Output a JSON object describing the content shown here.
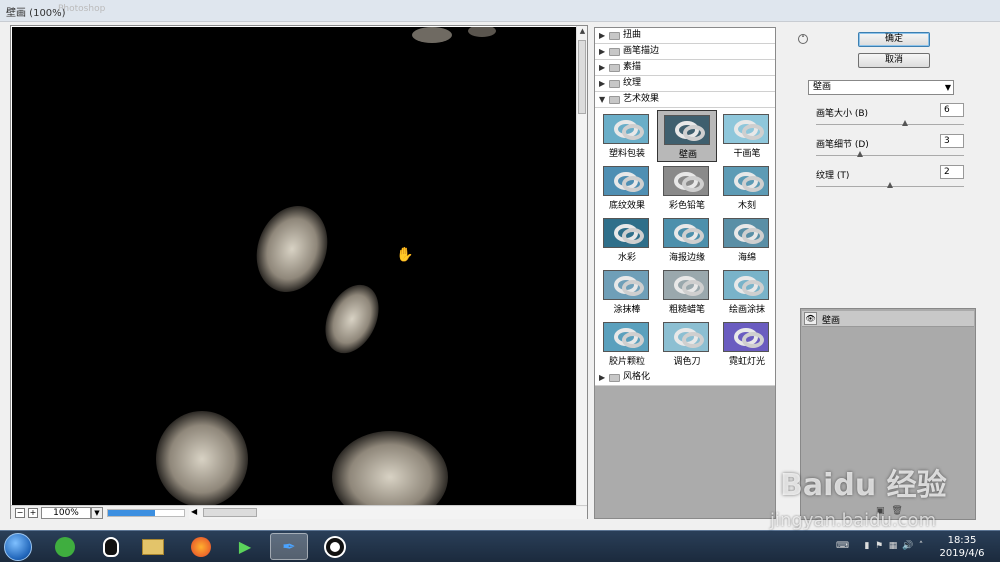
{
  "window": {
    "title": "壁画 (100%)",
    "ghost_title": "Photoshop"
  },
  "preview": {
    "zoom": "100%",
    "progress_fraction": 0.62
  },
  "filter_categories_top": [
    {
      "label": "扭曲"
    },
    {
      "label": "画笔描边"
    },
    {
      "label": "素描"
    },
    {
      "label": "纹理"
    },
    {
      "label": "艺术效果"
    }
  ],
  "artistic_filters": [
    {
      "label": "塑料包装",
      "color": "#6aaec8"
    },
    {
      "label": "壁画",
      "color": "#3f5f6e",
      "selected": true
    },
    {
      "label": "干画笔",
      "color": "#8fc7db"
    },
    {
      "label": "底纹效果",
      "color": "#4f8fb3"
    },
    {
      "label": "彩色铅笔",
      "color": "#8a8a8a"
    },
    {
      "label": "木刻",
      "color": "#5d9bb5"
    },
    {
      "label": "水彩",
      "color": "#2f6f8a"
    },
    {
      "label": "海报边缘",
      "color": "#4d90ac"
    },
    {
      "label": "海绵",
      "color": "#5a8fa6"
    },
    {
      "label": "涂抹棒",
      "color": "#6f9fb8"
    },
    {
      "label": "粗糙蜡笔",
      "color": "#9aa8ad"
    },
    {
      "label": "绘画涂抹",
      "color": "#79b3c9"
    },
    {
      "label": "胶片颗粒",
      "color": "#5aa0bd"
    },
    {
      "label": "调色刀",
      "color": "#8cbfd2"
    },
    {
      "label": "霓虹灯光",
      "color": "#6a5cc0"
    }
  ],
  "filter_categories_bottom": [
    {
      "label": "风格化"
    }
  ],
  "buttons": {
    "ok": "确定",
    "cancel": "取消"
  },
  "selected_filter": "壁画",
  "params": [
    {
      "label": "画笔大小 (B)",
      "value": "6",
      "slider_fraction": 0.6
    },
    {
      "label": "画笔细节 (D)",
      "value": "3",
      "slider_fraction": 0.3
    },
    {
      "label": "纹理 (T)",
      "value": "2",
      "slider_fraction": 0.5
    }
  ],
  "layer": {
    "name": "壁画"
  },
  "taskbar": {
    "time": "18:35",
    "date": "2019/4/6"
  },
  "watermark": {
    "logo": "Baidu 经验",
    "url": "jingyan.baidu.com"
  }
}
